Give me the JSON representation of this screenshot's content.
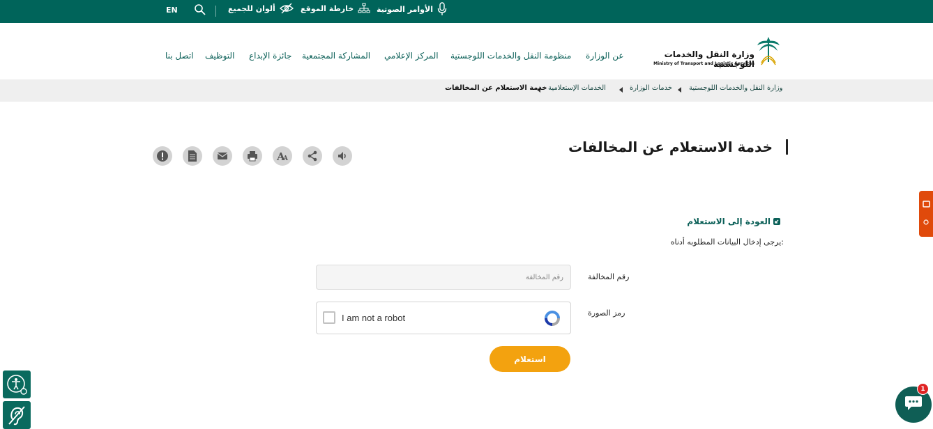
{
  "topbar": {
    "lang": "EN",
    "colors_label": "ألوان للجميع",
    "sitemap_label": "خارطة الموقع",
    "voice_label": "الأوامر الصوتية"
  },
  "header": {
    "logo_title": "وزارة النقل والخدمات اللوجستية",
    "logo_subtitle": "Ministry of Transport and Logistic Services",
    "nav": [
      "عن الوزارة",
      "منظومة النقل والخدمات اللوجستية",
      "المركز الإعلامي",
      "المشاركة المجتمعية",
      "جائزة الإبداع",
      "التوظيف",
      "اتصل بنا"
    ]
  },
  "breadcrumb": [
    "وزارة النقل والخدمات اللوجستية",
    "خدمات الوزارة",
    "الخدمات الإستعلامية",
    "خدمة الاستعلام عن المخالفات"
  ],
  "page": {
    "title": "خدمة الاستعلام عن المخالفات",
    "tools": [
      "listen-icon",
      "share-icon",
      "font-size-icon",
      "print-icon",
      "email-icon",
      "document-icon",
      "report-icon"
    ]
  },
  "form": {
    "back_link": "العودة إلى الاستعلام",
    "intro": "يرجى إدخال البيانات المطلوبه أدناه:",
    "violation_label": "رقم المخالفة",
    "violation_placeholder": "رقم المخالفة",
    "violation_value": "",
    "captcha_label": "رمز الصورة",
    "captcha_text": "I am not a robot",
    "submit_label": "استعلام"
  },
  "chat": {
    "badge": "1"
  },
  "colors": {
    "primary": "#00645a",
    "accent": "#f3a20f",
    "side_tab": "#e04a0b"
  }
}
